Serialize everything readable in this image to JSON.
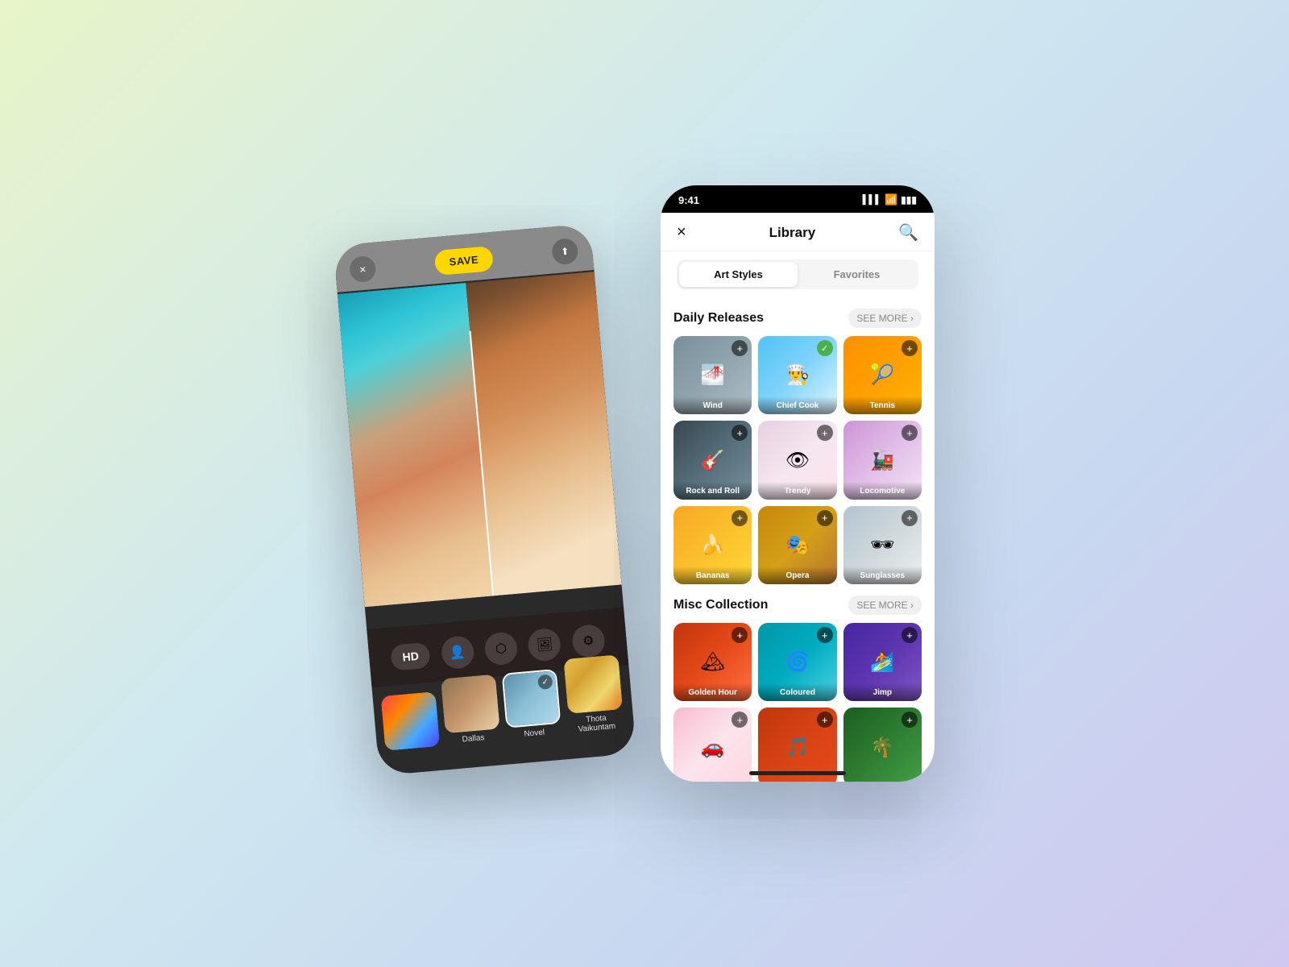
{
  "background": "#dce8f0",
  "left_phone": {
    "save_label": "SAVE",
    "close_icon": "×",
    "share_icon": "↑",
    "hd_label": "HD",
    "filters": [
      {
        "label": "Dallas",
        "selected": false
      },
      {
        "label": "Novel",
        "selected": true
      },
      {
        "label": "Thota Vaikuntam",
        "selected": false
      }
    ],
    "controls": [
      "HD",
      "person",
      "shape",
      "photo",
      "sliders"
    ]
  },
  "right_phone": {
    "status": {
      "time": "9:41",
      "signal": "▌▌▌",
      "wifi": "WiFi",
      "battery": "Battery"
    },
    "header": {
      "title": "Library",
      "close_icon": "×",
      "search_icon": "🔍"
    },
    "tabs": [
      {
        "label": "Art Styles",
        "active": true
      },
      {
        "label": "Favorites",
        "active": false
      }
    ],
    "sections": [
      {
        "title": "Daily Releases",
        "see_more": "SEE MORE ›",
        "items": [
          {
            "label": "Wind",
            "selected": false,
            "bg": "bg-wind"
          },
          {
            "label": "Chief Cook",
            "selected": true,
            "bg": "bg-chiefcook"
          },
          {
            "label": "Tennis",
            "selected": false,
            "bg": "bg-tennis"
          },
          {
            "label": "Rock and Roll",
            "selected": false,
            "bg": "bg-rocknroll"
          },
          {
            "label": "Trendy",
            "selected": false,
            "bg": "bg-trendy"
          },
          {
            "label": "Locomotive",
            "selected": false,
            "bg": "bg-locomotive"
          },
          {
            "label": "Bananas",
            "selected": false,
            "bg": "bg-bananas"
          },
          {
            "label": "Opera",
            "selected": false,
            "bg": "bg-opera"
          },
          {
            "label": "Sunglasses",
            "selected": false,
            "bg": "bg-sunglasses"
          }
        ]
      },
      {
        "title": "Misc Collection",
        "see_more": "SEE MORE ›",
        "items": [
          {
            "label": "Golden Hour",
            "selected": false,
            "bg": "bg-goldenhour"
          },
          {
            "label": "Coloured",
            "selected": false,
            "bg": "bg-coloured"
          },
          {
            "label": "Jimp",
            "selected": false,
            "bg": "bg-jimp"
          },
          {
            "label": "",
            "selected": false,
            "bg": "bg-misc1"
          },
          {
            "label": "",
            "selected": false,
            "bg": "bg-misc2"
          },
          {
            "label": "",
            "selected": false,
            "bg": "bg-misc3"
          }
        ]
      }
    ]
  }
}
